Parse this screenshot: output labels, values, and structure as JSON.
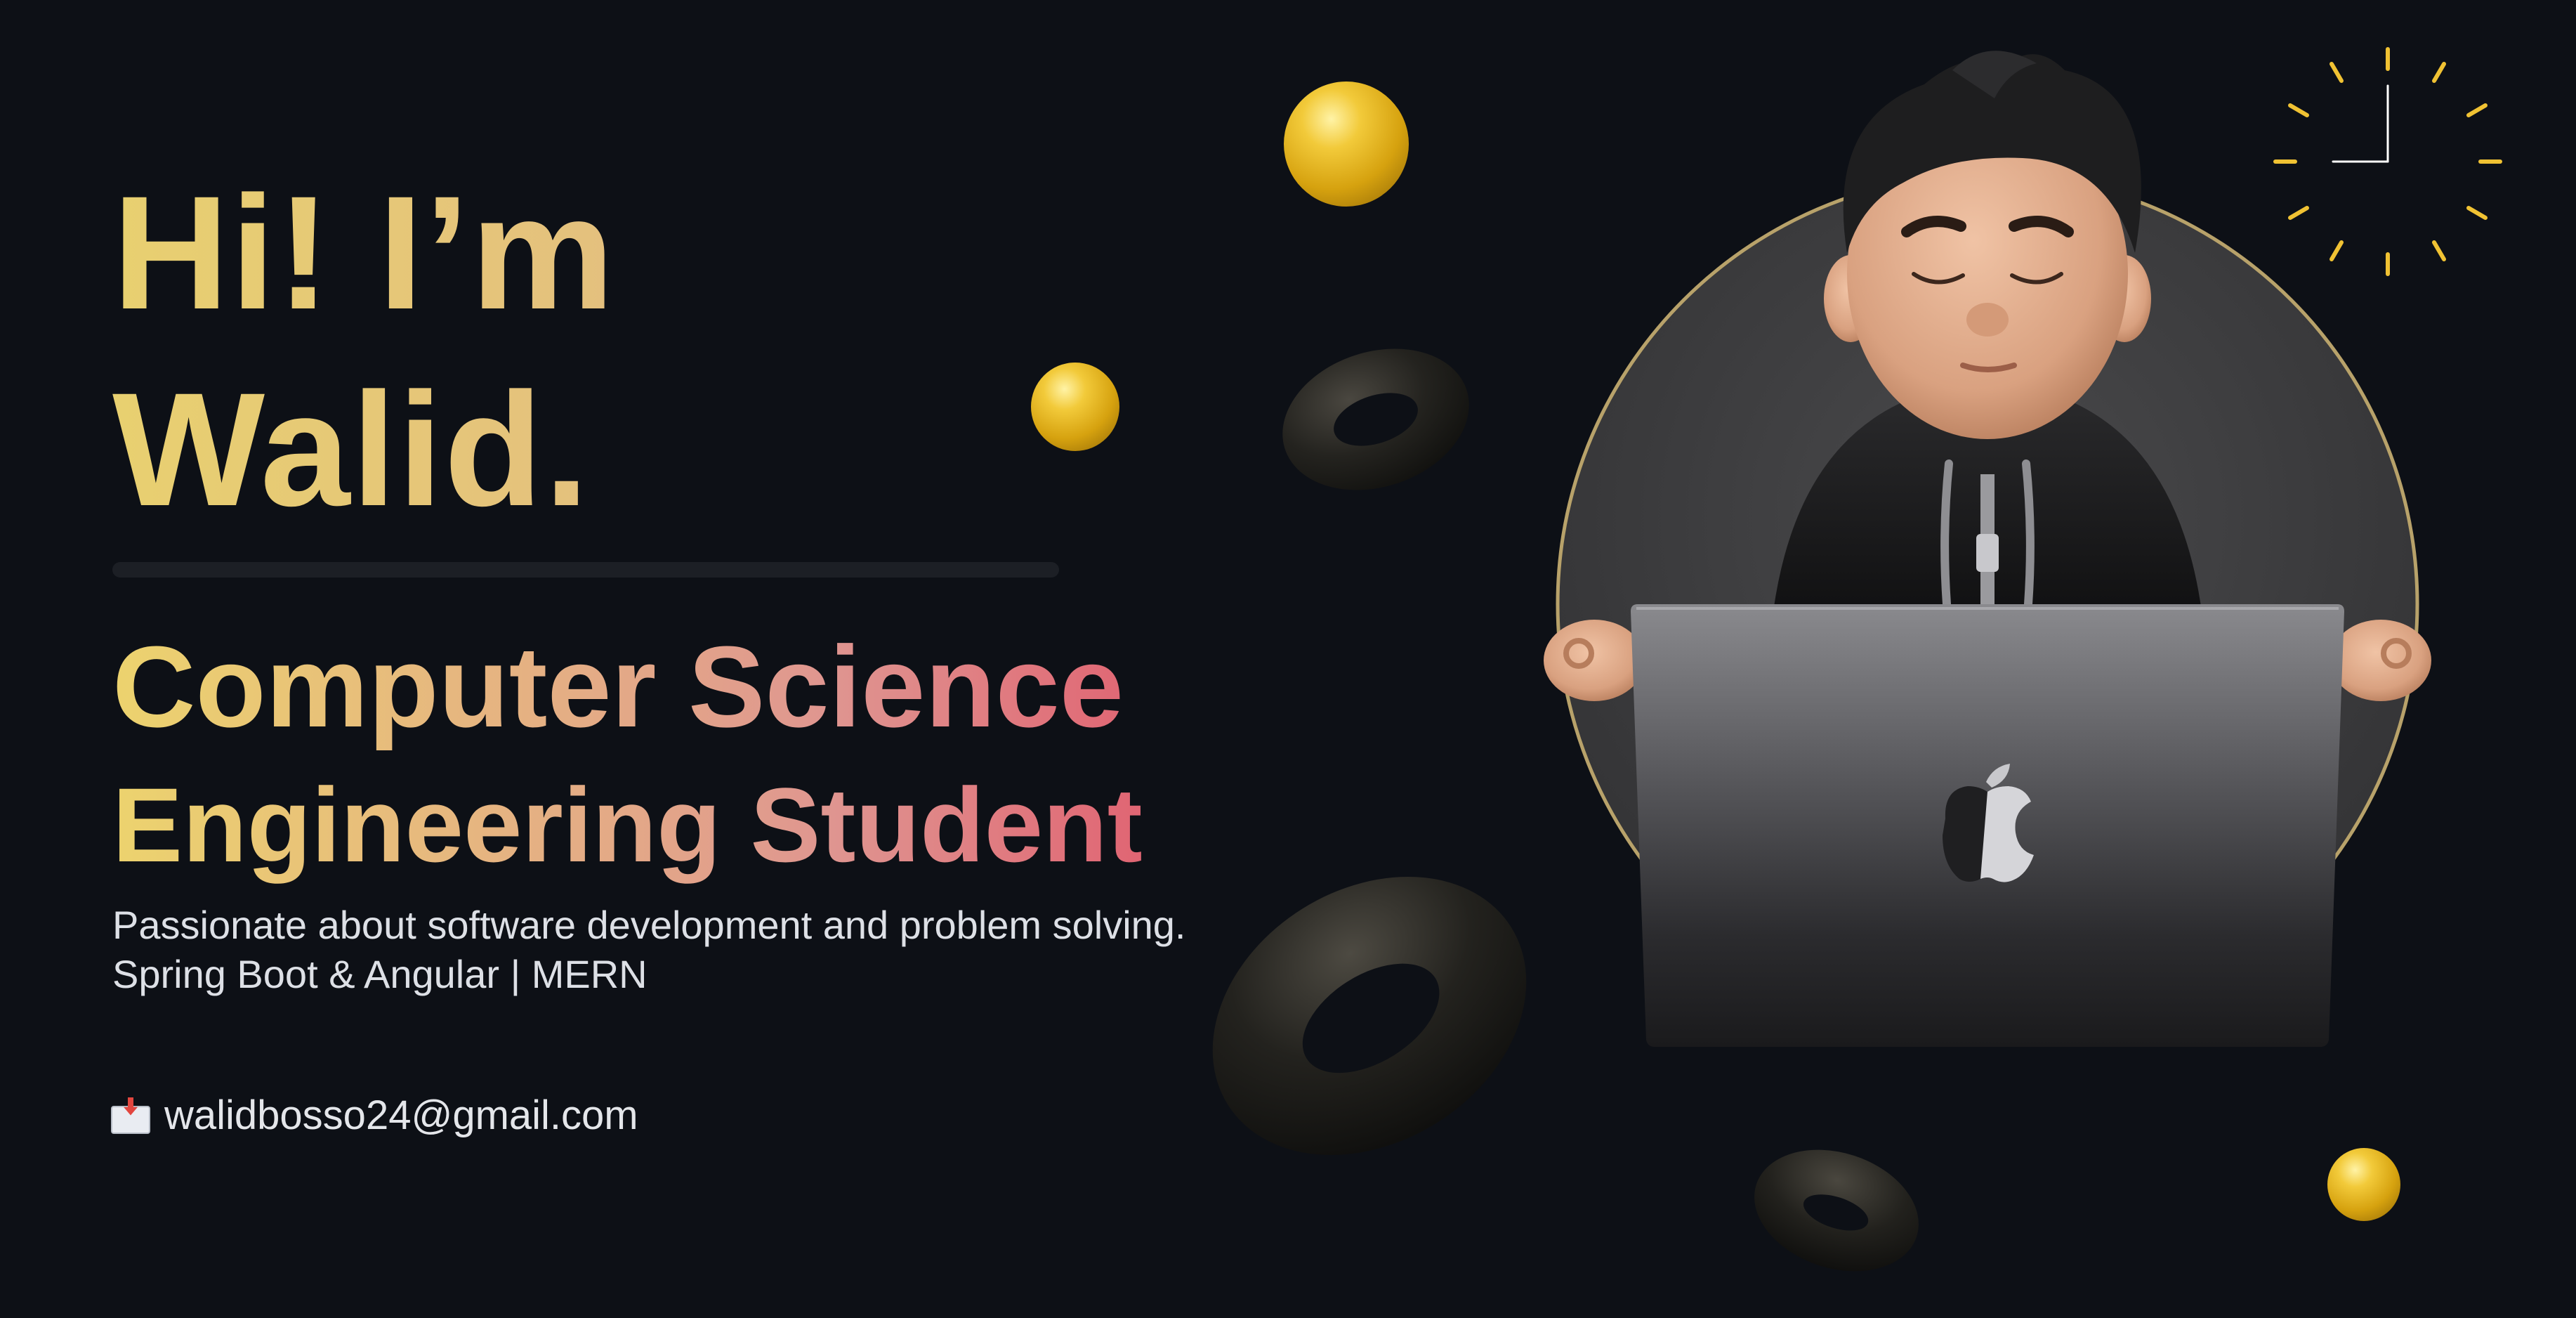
{
  "hero": {
    "greeting_line1": "Hi! I’m",
    "greeting_line2": "Walid.",
    "subtitle_line1": "Computer Science",
    "subtitle_line2": "Engineering Student",
    "tagline_line1": "Passionate about software development and problem solving.",
    "tagline_line2": "Spring Boot & Angular | MERN",
    "email": "walidbosso24@gmail.com",
    "email_icon": "incoming-envelope-icon"
  },
  "decor": {
    "clock_icon": "clock-icon",
    "avatar": "memoji-with-laptop",
    "laptop_logo": "apple-logo-icon"
  },
  "colors": {
    "background": "#0d1016",
    "greeting": "#e6c873",
    "gradient_start": "#ecd36e",
    "gradient_end": "#e06573",
    "text": "#dde0e6",
    "accent_gold": "#f2ca3a"
  }
}
